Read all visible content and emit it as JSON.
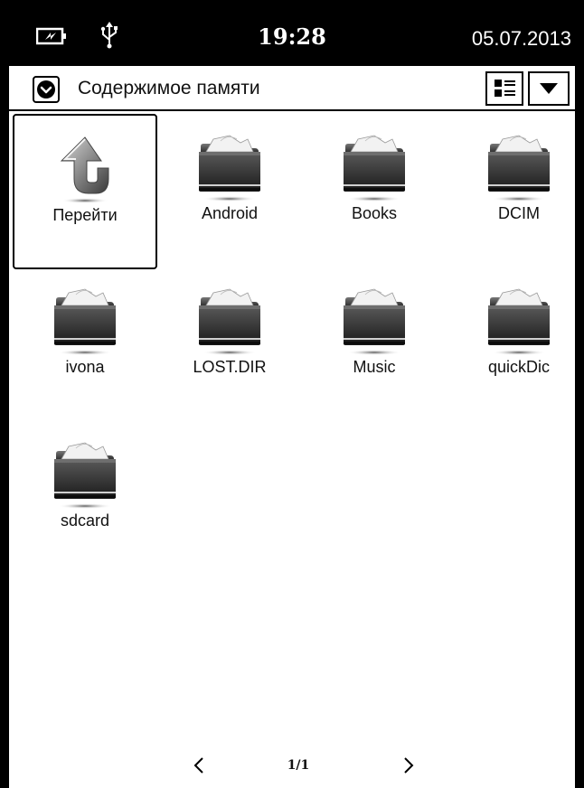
{
  "statusbar": {
    "battery_icon": "battery-charging-icon",
    "usb_icon": "usb-icon",
    "time": "19:28",
    "date": "05.07.2013"
  },
  "header": {
    "source_icon": "chevron-down-circle-icon",
    "title": "Содержимое памяти",
    "view_icon": "list-view-icon",
    "dropdown_icon": "triangle-down-icon"
  },
  "grid": {
    "items": [
      {
        "label": "Перейти",
        "icon": "up-arrow-icon",
        "selected": true
      },
      {
        "label": "Android",
        "icon": "folder-icon"
      },
      {
        "label": "Books",
        "icon": "folder-icon"
      },
      {
        "label": "DCIM",
        "icon": "folder-icon"
      },
      {
        "label": "ivona",
        "icon": "folder-icon"
      },
      {
        "label": "LOST.DIR",
        "icon": "folder-icon"
      },
      {
        "label": "Music",
        "icon": "folder-icon"
      },
      {
        "label": "quickDic",
        "icon": "folder-icon"
      },
      {
        "label": "sdcard",
        "icon": "folder-icon"
      }
    ]
  },
  "pager": {
    "prev_label": "<",
    "next_label": ">",
    "page": "1/1"
  }
}
